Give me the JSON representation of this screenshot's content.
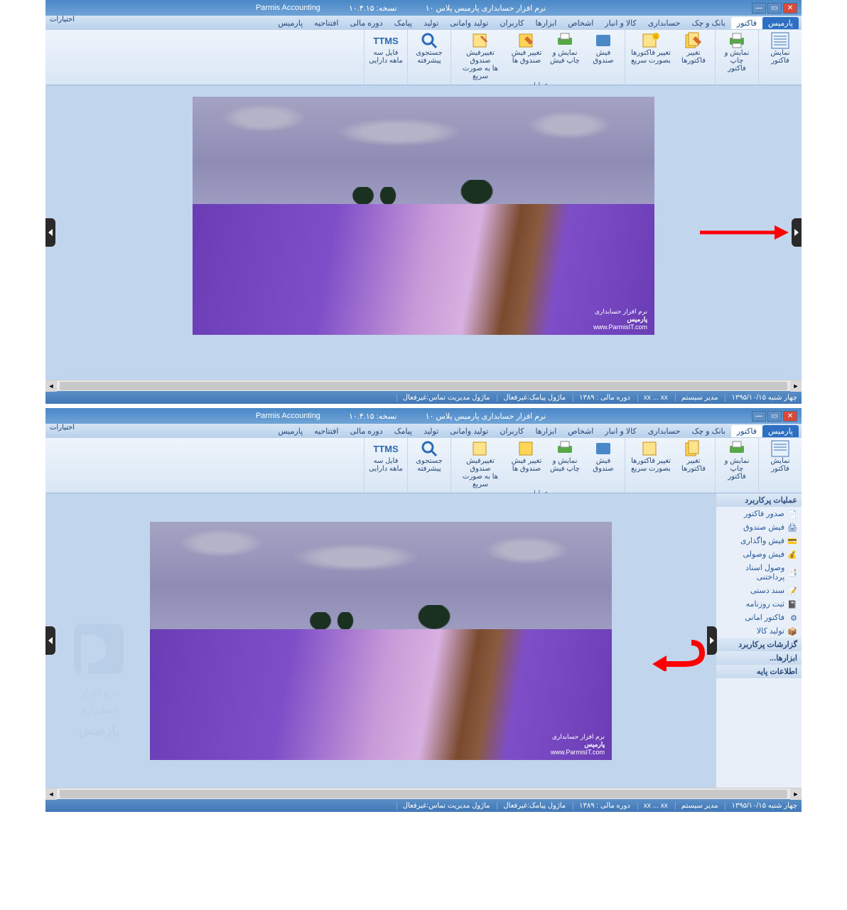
{
  "title": {
    "app": "نرم افزار حسابداری پارمیس پلاس ۱۰",
    "company": "Parmis Accounting",
    "version": "نسخه: ۱۰.۴.۱۵"
  },
  "quick_label": "اختیارات",
  "menu": [
    "پارمیس",
    "فاکتور",
    "بانک و چک",
    "حسابداری",
    "کالا و انبار",
    "اشخاص",
    "ابزارها",
    "کاربران",
    "تولید وامانی",
    "تولید",
    "پیامک",
    "دوره مالی",
    "افتتاحیه",
    "پارمیس"
  ],
  "ribbon": [
    {
      "items": [
        {
          "ico": "table",
          "l1": "نمایش",
          "l2": "فاکتور"
        }
      ]
    },
    {
      "items": [
        {
          "ico": "printg",
          "l1": "نمایش و چاپ",
          "l2": "فاکتور"
        }
      ]
    },
    {
      "items": [
        {
          "ico": "facs",
          "l1": "تغییر",
          "l2": "فاکتورها"
        },
        {
          "ico": "star",
          "l1": "تغییر فاکتورها",
          "l2": "بصورت سریع"
        }
      ]
    },
    {
      "group": "عملیات",
      "items": [
        {
          "ico": "blue",
          "l1": "فیش",
          "l2": "صندوق"
        },
        {
          "ico": "print",
          "l1": "نمایش و",
          "l2": "چاپ فیش"
        },
        {
          "ico": "edit",
          "l1": "تغییر فیش",
          "l2": "صندوق ها"
        },
        {
          "ico": "fast",
          "l1": "تغییرفیش صندوق",
          "l2": "ها به صورت سریع"
        }
      ]
    },
    {
      "items": [
        {
          "ico": "search",
          "l1": "جستجوی",
          "l2": "پیشرفته"
        }
      ]
    },
    {
      "items": [
        {
          "ico": "ttms",
          "l1": "فایل سه",
          "l2": "ماهه دارایی"
        }
      ]
    }
  ],
  "side": {
    "head1": "عملیات پرکاربرد",
    "items": [
      "صدور فاکتور",
      "فیش صندوق",
      "فیش واگذاری",
      "فیش وصولی",
      "وصول اسناد پرداختنی",
      "سند دستی",
      "ثبت روزنامه",
      "فاکتور امانی",
      "تولید کالا"
    ],
    "head2": "گزارشات پرکاربرد",
    "head3": "ابزارها...",
    "head4": "اطلاعات پایه"
  },
  "status": {
    "date": "چهار شنبه ۱۳۹۵/۱۰/۱۵",
    "admin": "مدیر سیستم",
    "xx": "xx  ...  xx",
    "period": "دوره مالی : ۱۳۸۹",
    "sms": "ماژول پیامک:غیرفعال",
    "call": "ماژول مدیریت تماس:غیرفعال"
  },
  "wm": {
    "l1": "نرم افزار",
    "l2": "حسابداری",
    "l3": "پارمیس",
    "url": "www.ParmisIT.com"
  }
}
